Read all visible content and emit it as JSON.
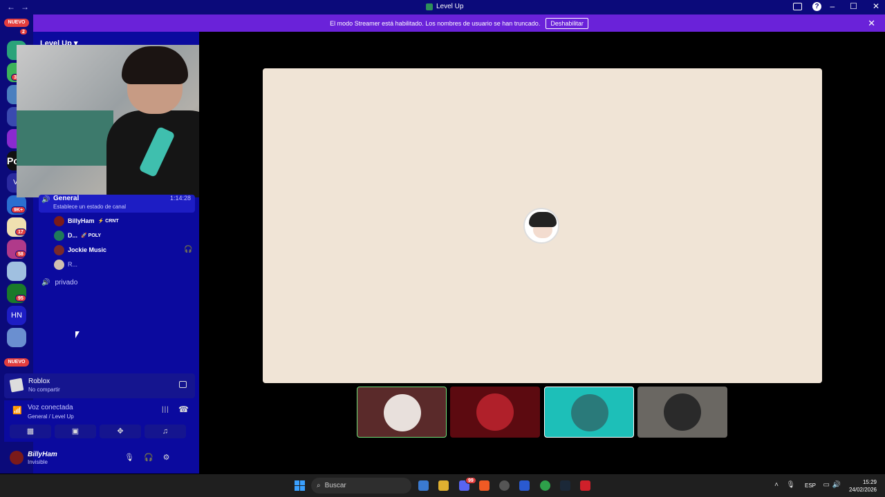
{
  "window": {
    "title": "Level Up",
    "nav_back": "←",
    "nav_forward": "→"
  },
  "banner": {
    "message": "El modo Streamer está habilitado. Los nombres de usuario se han truncado.",
    "button": "Deshabilitar"
  },
  "serverbar": {
    "nuevo_top": "NUEVO",
    "nuevo_bottom": "NUEVO",
    "badges": [
      "2",
      "3",
      "9K+",
      "17",
      "58",
      "95"
    ],
    "hn": "HN",
    "vr": "Vr",
    "pc": "Pc"
  },
  "server": {
    "name": "Level Up"
  },
  "channels": {
    "general": {
      "name": "General",
      "status": "Establece un estado de canal",
      "time": "1:14:28"
    },
    "members": [
      {
        "name": "BillyHam",
        "tag": "⚡ CRNT",
        "color": "#7a1a1a"
      },
      {
        "name": "D...",
        "tag": "🚀 POLY",
        "color": "#1f7a5a"
      },
      {
        "name": "Jockie Music",
        "tag": "",
        "color": "#7a2a2a"
      },
      {
        "name": "R...",
        "tag": "",
        "color": "#d0c0b0"
      }
    ],
    "private": "privado"
  },
  "activity": {
    "title": "Roblox",
    "subtitle": "No compartir"
  },
  "voice": {
    "title": "Voz conectada",
    "subtitle": "General / Level Up"
  },
  "user": {
    "name": "BillyHam",
    "status": "Invisible"
  },
  "taskbar": {
    "search": "Buscar",
    "lang": "ESP",
    "time": "15:29",
    "date": "24/02/2026",
    "discord_badge": "99"
  },
  "colors": {
    "accent": "#6a22d9",
    "sidebar": "#0b0a9e",
    "stage_bg": "#f0e4d6"
  }
}
